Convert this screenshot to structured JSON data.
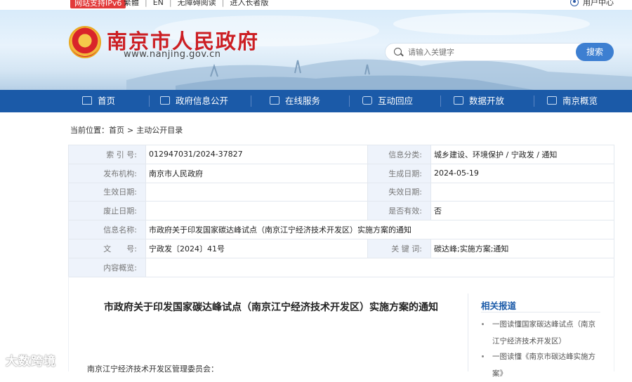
{
  "topbar": {
    "ipv6_badge": "网站支持IPv6",
    "links": [
      "繁體",
      "EN",
      "无障碍阅读",
      "进入长者版"
    ],
    "user_center": "用户中心"
  },
  "header": {
    "title": "南京市人民政府",
    "url": "www.nanjing.gov.cn",
    "search_placeholder": "请输入关键字",
    "search_button": "搜索"
  },
  "nav": {
    "items": [
      {
        "label": "首页",
        "icon": "home-icon"
      },
      {
        "label": "政府信息公开",
        "icon": "document-icon"
      },
      {
        "label": "在线服务",
        "icon": "thumb-icon"
      },
      {
        "label": "互动回应",
        "icon": "chat-icon"
      },
      {
        "label": "数据开放",
        "icon": "data-icon"
      },
      {
        "label": "南京概览",
        "icon": "building-icon"
      }
    ]
  },
  "breadcrumb": {
    "prefix": "当前位置：",
    "items": [
      "首页",
      "主动公开目录"
    ]
  },
  "info": {
    "rows": [
      {
        "k1": "索 引 号:",
        "v1": "012947031/2024-37827",
        "k2": "信息分类:",
        "v2": "城乡建设、环境保护 / 宁政发 / 通知"
      },
      {
        "k1": "发布机构:",
        "v1": "南京市人民政府",
        "k2": "生成日期:",
        "v2": "2024-05-19"
      },
      {
        "k1": "生效日期:",
        "v1": "",
        "k2": "失效日期:",
        "v2": ""
      },
      {
        "k1": "废止日期:",
        "v1": "",
        "k2": "是否有效:",
        "v2": "否"
      }
    ],
    "name_label": "信息名称:",
    "name_value": "市政府关于印发国家碳达峰试点（南京江宁经济技术开发区）实施方案的通知",
    "doc_label": "文　　号:",
    "doc_value": "宁政发〔2024〕41号",
    "kw_label": "关 键 词:",
    "kw_value": "碳达峰;实施方案;通知",
    "summary_label": "内容概览:",
    "summary_value": ""
  },
  "content": {
    "title": "市政府关于印发国家碳达峰试点（南京江宁经济技术开发区）实施方案的通知",
    "salutation": "南京江宁经济技术开发区管理委员会：",
    "related_title": "相关报道",
    "related": [
      "一图读懂国家碳达峰试点（南京江宁经济技术开发区）",
      "一图读懂《南京市碳达峰实施方案》"
    ]
  },
  "watermark": "大数跨境"
}
